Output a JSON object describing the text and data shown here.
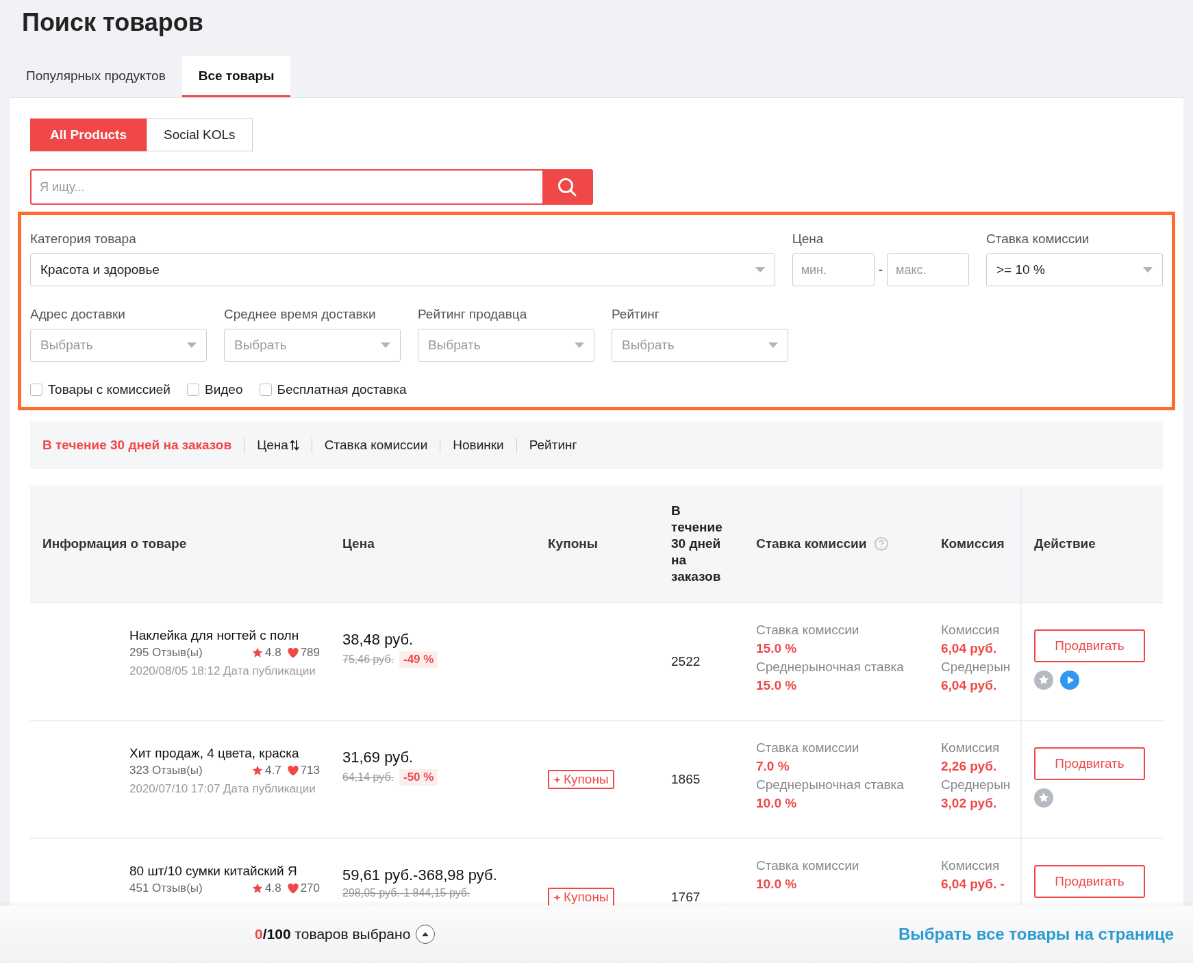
{
  "page_title": "Поиск товаров",
  "tabs": [
    {
      "label": "Популярных продуктов",
      "selected": false
    },
    {
      "label": "Все товары",
      "selected": true
    }
  ],
  "segments": [
    {
      "label": "All Products",
      "selected": true
    },
    {
      "label": "Social KOLs",
      "selected": false
    }
  ],
  "search": {
    "placeholder": "Я ищу..."
  },
  "filters": {
    "category": {
      "label": "Категория товара",
      "value": "Красота и здоровье"
    },
    "price": {
      "label": "Цена",
      "min_placeholder": "мин.",
      "separator": "-",
      "max_placeholder": "макс."
    },
    "commission": {
      "label": "Ставка комиссии",
      "value": ">= 10 %"
    },
    "dropdowns": [
      {
        "label": "Адрес доставки",
        "placeholder": "Выбрать"
      },
      {
        "label": "Среднее время доставки",
        "placeholder": "Выбрать"
      },
      {
        "label": "Рейтинг продавца",
        "placeholder": "Выбрать"
      },
      {
        "label": "Рейтинг",
        "placeholder": "Выбрать"
      }
    ],
    "checkboxes": [
      {
        "label": "Товары с комиссией",
        "checked": false
      },
      {
        "label": "Видео",
        "checked": false
      },
      {
        "label": "Бесплатная доставка",
        "checked": false
      }
    ]
  },
  "sort": [
    {
      "label": "В течение 30 дней на заказов",
      "selected": true,
      "sortable": false
    },
    {
      "label": "Цена",
      "selected": false,
      "sortable": true
    },
    {
      "label": "Ставка комиссии",
      "selected": false,
      "sortable": false
    },
    {
      "label": "Новинки",
      "selected": false,
      "sortable": false
    },
    {
      "label": "Рейтинг",
      "selected": false,
      "sortable": false
    }
  ],
  "table": {
    "columns": [
      "Информация о товаре",
      "Цена",
      "Купоны",
      "В течение 30 дней на заказов",
      "Ставка комиссии",
      "Комиссия",
      "Действие"
    ],
    "rows": [
      {
        "name": "Наклейка для ногтей с полн",
        "reviews": "295 Отзыв(ы)",
        "rating": "4.8",
        "likes": "789",
        "date": "2020/08/05 18:12 Дата публикации",
        "price": "38,48 руб.",
        "old_price": "75,46 руб.",
        "discount": "-49 %",
        "coupon": null,
        "orders": "2522",
        "rate_label": "Ставка комиссии",
        "rate": "15.0 %",
        "market_rate_label": "Среднерыночная ставка",
        "market_rate": "15.0 %",
        "commission_label": "Комиссия",
        "commission": "6,04 руб.",
        "market_commission_label": "Среднерын",
        "market_commission": "6,04 руб.",
        "action": "Продвигать",
        "badges": [
          {
            "kind": "favorite"
          },
          {
            "kind": "video"
          }
        ]
      },
      {
        "name": "Хит продаж, 4 цвета, краска",
        "reviews": "323 Отзыв(ы)",
        "rating": "4.7",
        "likes": "713",
        "date": "2020/07/10 17:07 Дата публикации",
        "price": "31,69 руб.",
        "old_price": "64,14 руб.",
        "discount": "-50 %",
        "coupon": "Купоны",
        "orders": "1865",
        "rate_label": "Ставка комиссии",
        "rate": "7.0 %",
        "market_rate_label": "Среднерыночная ставка",
        "market_rate": "10.0 %",
        "commission_label": "Комиссия",
        "commission": "2,26 руб.",
        "market_commission_label": "Среднерын",
        "market_commission": "3,02 руб.",
        "action": "Продвигать",
        "badges": [
          {
            "kind": "favorite"
          }
        ]
      },
      {
        "name": "80 шт/10 сумки китайский Я",
        "reviews": "451 Отзыв(ы)",
        "rating": "4.8",
        "likes": "270",
        "price": "59,61 руб.-368,98 руб.",
        "old_price": "298,05 руб.-1 844,15 руб.",
        "coupon": "Купоны",
        "orders": "1767",
        "rate_label": "Ставка комиссии",
        "rate": "10.0 %",
        "commission_label": "Комиссия",
        "commission": "6,04 руб. -",
        "action": "Продвигать",
        "badges": []
      }
    ]
  },
  "footer": {
    "selected_count": "0",
    "total": "/100",
    "selected_text": "товаров выбрано",
    "select_all": "Выбрать все товары на странице"
  }
}
